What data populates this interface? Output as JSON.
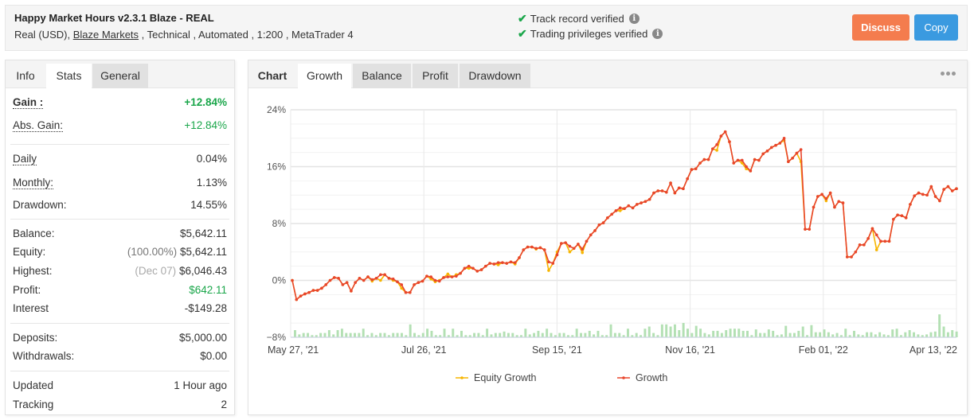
{
  "header": {
    "title": "Happy Market Hours v2.3.1 Blaze - REAL",
    "subtitle_prefix": "Real (USD), ",
    "broker_link": "Blaze Markets",
    "subtitle_suffix": " , Technical , Automated , 1:200 , MetaTrader 4",
    "verifications": [
      {
        "label": "Track record verified",
        "icon": "check-icon"
      },
      {
        "label": "Trading privileges verified",
        "icon": "check-icon"
      }
    ],
    "discuss_label": "Discuss",
    "copy_label": "Copy",
    "colors": {
      "discuss": "#f47c4e",
      "copy": "#3a9ae0",
      "verified": "#1aa64a"
    }
  },
  "left_panel": {
    "tabs": [
      {
        "label": "Info",
        "state": "plain"
      },
      {
        "label": "Stats",
        "state": "active"
      },
      {
        "label": "General",
        "state": "inactive"
      }
    ],
    "stats": {
      "gain": {
        "label": "Gain :",
        "value": "+12.84%"
      },
      "abs_gain": {
        "label": "Abs. Gain:",
        "value": "+12.84%"
      },
      "daily": {
        "label": "Daily",
        "value": "0.04%"
      },
      "monthly": {
        "label": "Monthly:",
        "value": "1.13%"
      },
      "drawdown": {
        "label": "Drawdown:",
        "value": "14.55%"
      },
      "balance": {
        "label": "Balance:",
        "value": "$5,642.11"
      },
      "equity": {
        "label": "Equity:",
        "note": "(100.00%)",
        "value": "$5,642.11"
      },
      "highest": {
        "label": "Highest:",
        "note": "(Dec 07)",
        "value": "$6,046.43"
      },
      "profit": {
        "label": "Profit:",
        "value": "$642.11"
      },
      "interest": {
        "label": "Interest",
        "value": "-$149.28"
      },
      "deposits": {
        "label": "Deposits:",
        "value": "$5,000.00"
      },
      "withdrawals": {
        "label": "Withdrawals:",
        "value": "$0.00"
      },
      "updated": {
        "label": "Updated",
        "value": "1 Hour ago"
      },
      "tracking": {
        "label": "Tracking",
        "value": "2"
      }
    }
  },
  "right_panel": {
    "tabs": [
      {
        "label": "Chart",
        "state": "plain"
      },
      {
        "label": "Growth",
        "state": "active"
      },
      {
        "label": "Balance",
        "state": "inactive"
      },
      {
        "label": "Profit",
        "state": "inactive"
      },
      {
        "label": "Drawdown",
        "state": "inactive"
      }
    ],
    "more_icon": "more-horizontal-icon"
  },
  "chart_data": {
    "type": "line",
    "title": "",
    "xlabel": "",
    "ylabel": "",
    "ylim": [
      -8,
      24
    ],
    "y_ticks": [
      "24%",
      "16%",
      "8%",
      "0%",
      "−8%"
    ],
    "y_tick_values": [
      24,
      16,
      8,
      0,
      -8
    ],
    "x_ticks": [
      "May 27, '21",
      "Jul 26, '21",
      "Sep 15, '21",
      "Nov 16, '21",
      "Feb 01, '22",
      "Apr 13, '22"
    ],
    "grid": true,
    "legend": "bottom-center",
    "series": [
      {
        "name": "Growth",
        "color": "#e8452c",
        "values": [
          0.0,
          -2.7,
          -2.2,
          -1.9,
          -1.7,
          -1.4,
          -1.4,
          -1.1,
          -0.6,
          0.0,
          0.4,
          0.3,
          -0.6,
          -0.3,
          -1.5,
          -0.3,
          0.3,
          0.0,
          0.5,
          0.1,
          0.3,
          0.8,
          0.8,
          0.3,
          0.2,
          -0.2,
          -0.6,
          -1.7,
          -1.7,
          -0.6,
          -0.3,
          -0.1,
          0.6,
          0.5,
          0.0,
          -0.1,
          0.4,
          0.5,
          0.5,
          0.6,
          1.0,
          1.7,
          2.0,
          1.7,
          1.3,
          1.5,
          2.0,
          2.4,
          2.3,
          2.5,
          2.5,
          2.4,
          2.6,
          2.5,
          3.2,
          4.3,
          4.7,
          4.7,
          4.5,
          4.6,
          4.3,
          2.6,
          2.4,
          3.6,
          5.2,
          5.3,
          4.8,
          4.5,
          5.1,
          4.4,
          5.5,
          6.4,
          7.0,
          7.8,
          8.1,
          8.8,
          9.3,
          9.8,
          10.2,
          10.1,
          10.5,
          10.2,
          10.7,
          10.9,
          11.1,
          11.4,
          12.3,
          12.6,
          12.6,
          12.4,
          13.7,
          12.3,
          13.0,
          12.9,
          14.3,
          15.6,
          15.7,
          16.5,
          17.0,
          17.0,
          18.5,
          19.1,
          20.3,
          20.9,
          19.5,
          16.5,
          16.9,
          16.9,
          16.0,
          15.4,
          17.0,
          16.9,
          17.8,
          18.2,
          18.7,
          19.0,
          19.3,
          20.0,
          16.7,
          17.2,
          17.9,
          18.4,
          7.2,
          7.2,
          10.3,
          11.8,
          12.1,
          11.5,
          12.3,
          10.3,
          11.1,
          10.9,
          3.3,
          3.3,
          4.0,
          5.0,
          5.0,
          5.9,
          7.3,
          6.4,
          5.5,
          5.5,
          5.5,
          8.6,
          9.2,
          9.1,
          8.8,
          10.7,
          11.9,
          12.3,
          12.1,
          12.0,
          13.2,
          11.8,
          11.2,
          12.8,
          13.2,
          12.6,
          12.9
        ],
        "note": "approximate values read from chart"
      },
      {
        "name": "Equity Growth",
        "color": "#f7b500",
        "values": [
          0.0,
          -2.7,
          -2.2,
          -1.9,
          -1.7,
          -1.4,
          -1.4,
          -1.1,
          -0.6,
          0.0,
          0.4,
          0.3,
          -0.6,
          -0.3,
          -1.5,
          -0.3,
          0.3,
          0.0,
          0.5,
          -0.1,
          0.3,
          0.0,
          0.8,
          0.3,
          0.0,
          -0.2,
          -1.1,
          -1.7,
          -1.7,
          -0.6,
          -0.3,
          -0.1,
          0.6,
          0.2,
          -0.2,
          0.0,
          0.4,
          0.9,
          0.5,
          0.8,
          1.0,
          1.7,
          1.7,
          1.7,
          1.3,
          1.5,
          2.0,
          2.4,
          2.3,
          2.2,
          2.5,
          2.4,
          2.6,
          2.3,
          3.2,
          4.3,
          4.7,
          4.7,
          4.4,
          4.6,
          4.3,
          1.4,
          2.4,
          4.0,
          5.2,
          5.3,
          4.0,
          4.5,
          5.1,
          3.9,
          5.5,
          6.4,
          7.0,
          7.8,
          8.1,
          8.8,
          9.3,
          9.8,
          9.8,
          10.1,
          10.5,
          10.2,
          10.7,
          10.9,
          11.1,
          11.4,
          12.3,
          12.6,
          12.6,
          12.4,
          13.7,
          12.3,
          13.0,
          12.9,
          14.3,
          15.6,
          15.7,
          16.5,
          17.0,
          17.0,
          18.5,
          18.3,
          20.3,
          20.9,
          19.5,
          16.5,
          16.9,
          16.5,
          15.7,
          15.4,
          17.0,
          16.9,
          17.8,
          18.2,
          18.7,
          19.0,
          19.3,
          19.7,
          16.7,
          17.2,
          17.9,
          16.7,
          7.2,
          7.2,
          10.3,
          11.8,
          12.1,
          11.2,
          12.3,
          10.3,
          11.1,
          10.9,
          3.3,
          3.3,
          4.0,
          5.0,
          5.0,
          5.9,
          7.3,
          4.3,
          5.5,
          5.5,
          5.5,
          8.6,
          9.2,
          9.1,
          8.8,
          10.7,
          11.9,
          12.3,
          12.1,
          12.0,
          13.2,
          11.8,
          11.2,
          12.8,
          13.2,
          12.6,
          12.9
        ],
        "note": "approximate values read from chart"
      }
    ],
    "volume_bars": {
      "color": "#b3e0b3",
      "note": "secondary bar series along bottom (relative heights, 0-1)",
      "values": [
        0.5,
        0.2,
        0.3,
        0.3,
        0.15,
        0.15,
        0.3,
        0.3,
        0.5,
        0.2,
        0.5,
        0.6,
        0.3,
        0.3,
        0.3,
        0.3,
        0.6,
        0.15,
        0.3,
        0.15,
        0.3,
        0.3,
        0.15,
        0.3,
        0.3,
        0.3,
        0.15,
        0.9,
        0.3,
        0.15,
        0.3,
        0.6,
        0.45,
        0.15,
        0.15,
        0.6,
        0.15,
        0.6,
        0.15,
        0.45,
        0.15,
        0.15,
        0.3,
        0.3,
        0.15,
        0.6,
        0.2,
        0.3,
        0.3,
        0.4,
        0.3,
        0.3,
        0.15,
        0.15,
        0.6,
        0.2,
        0.3,
        0.45,
        0.3,
        0.6,
        0.3,
        0.15,
        0.3,
        0.3,
        0.15,
        0.15,
        0.6,
        0.3,
        0.3,
        0.45,
        0.2,
        0.45,
        0.15,
        0.15,
        0.9,
        0.3,
        0.3,
        0.15,
        0.6,
        0.15,
        0.3,
        0.15,
        0.6,
        0.75,
        0.3,
        0.15,
        0.9,
        0.9,
        0.75,
        0.9,
        0.5,
        1.0,
        0.6,
        0.3,
        0.8,
        0.6,
        0.3,
        0.2,
        0.45,
        0.45,
        0.3,
        0.5,
        0.6,
        0.6,
        0.6,
        0.45,
        0.45,
        0.15,
        0.55,
        0.3,
        0.3,
        0.55,
        0.45,
        0.15,
        0.2,
        0.8,
        0.3,
        0.3,
        0.45,
        0.75,
        0.15,
        0.85,
        0.35,
        0.35,
        0.55,
        0.35,
        0.2,
        0.3,
        0.15,
        0.6,
        0.15,
        0.45,
        0.2,
        0.15,
        0.35,
        0.35,
        0.2,
        0.35,
        0.2,
        0.15,
        0.55,
        0.6,
        0.15,
        0.35,
        0.5,
        0.35,
        0.2,
        0.15,
        0.2,
        0.35,
        0.4,
        1.6,
        0.75,
        0.35,
        0.5,
        0.4
      ]
    }
  }
}
